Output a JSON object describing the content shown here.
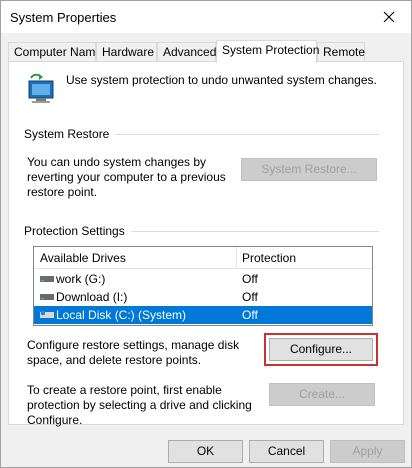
{
  "window": {
    "title": "System Properties"
  },
  "tabs": [
    {
      "label": "Computer Name"
    },
    {
      "label": "Hardware"
    },
    {
      "label": "Advanced"
    },
    {
      "label": "System Protection"
    },
    {
      "label": "Remote"
    }
  ],
  "active_tab": "System Protection",
  "intro": {
    "text": "Use system protection to undo unwanted system changes."
  },
  "system_restore": {
    "group_label": "System Restore",
    "description": "You can undo system changes by reverting your computer to a previous restore point.",
    "button_label": "System Restore..."
  },
  "protection_settings": {
    "group_label": "Protection Settings",
    "columns": [
      "Available Drives",
      "Protection"
    ],
    "drives": [
      {
        "name": "work (G:)",
        "protection": "Off",
        "selected": false
      },
      {
        "name": "Download (I:)",
        "protection": "Off",
        "selected": false
      },
      {
        "name": "Local Disk (C:) (System)",
        "protection": "Off",
        "selected": true
      }
    ],
    "configure_text": "Configure restore settings, manage disk space, and delete restore points.",
    "configure_button": "Configure...",
    "create_text": "To create a restore point, first enable protection by selecting a drive and clicking Configure.",
    "create_button": "Create..."
  },
  "footer": {
    "ok": "OK",
    "cancel": "Cancel",
    "apply": "Apply"
  },
  "colors": {
    "selection": "#0078d7",
    "highlight_box": "#c83232"
  }
}
